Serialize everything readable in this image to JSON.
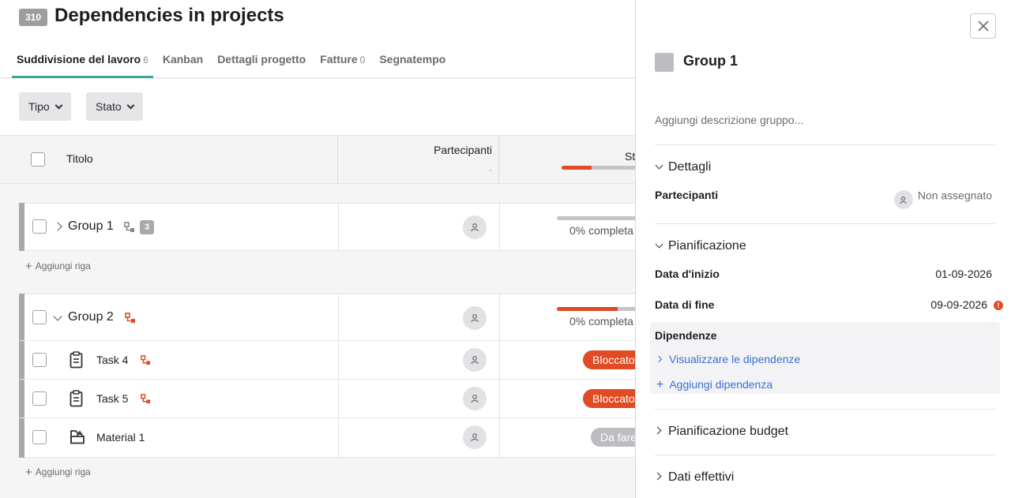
{
  "project": {
    "badge": "310",
    "title": "Dependencies in projects"
  },
  "tabs": [
    {
      "label": "Suddivisione del lavoro",
      "count": "6",
      "active": true
    },
    {
      "label": "Kanban",
      "count": ""
    },
    {
      "label": "Dettagli progetto",
      "count": ""
    },
    {
      "label": "Fatture",
      "count": "0"
    },
    {
      "label": "Segnatempo",
      "count": ""
    }
  ],
  "filters": {
    "type_label": "Tipo",
    "status_label": "Stato"
  },
  "table": {
    "col_title": "Titolo",
    "col_participants": "Partecipanti",
    "col_participants_sub": "-",
    "col_status": "St",
    "header_progress": 0.38,
    "add_row_label": "Aggiungi riga"
  },
  "groups": [
    {
      "name": "Group 1",
      "count": "3",
      "progress_text": "0% completa",
      "progress": 0,
      "expanded": false,
      "rows": []
    },
    {
      "name": "Group 2",
      "progress_text": "0% completa",
      "progress": 0.64,
      "expanded": true,
      "rows": [
        {
          "name": "Task 4",
          "type": "task",
          "status": "Bloccato",
          "status_color": "#e04a25"
        },
        {
          "name": "Task 5",
          "type": "task",
          "status": "Bloccato",
          "status_color": "#e04a25"
        },
        {
          "name": "Material 1",
          "type": "material",
          "status": "Da fare",
          "status_color": "#bdbdc1"
        }
      ]
    }
  ],
  "panel": {
    "title": "Group 1",
    "description_placeholder": "Aggiungi descrizione gruppo...",
    "details": {
      "heading": "Dettagli",
      "participants_label": "Partecipanti",
      "participants_value": "Non assegnato"
    },
    "planning": {
      "heading": "Pianificazione",
      "start_label": "Data d'inizio",
      "start_value": "01-09-2026",
      "end_label": "Data di fine",
      "end_value": "09-09-2026",
      "end_warning": "!",
      "deps_label": "Dipendenze",
      "view_deps": "Visualizzare le dipendenze",
      "add_dep": "Aggiungi dipendenza"
    },
    "budget_heading": "Pianificazione budget",
    "actuals_heading": "Dati effettivi"
  },
  "colors": {
    "accent": "#37a69a",
    "danger": "#e04a25",
    "link": "#3a6fd8",
    "muted": "#bdbdc1"
  }
}
